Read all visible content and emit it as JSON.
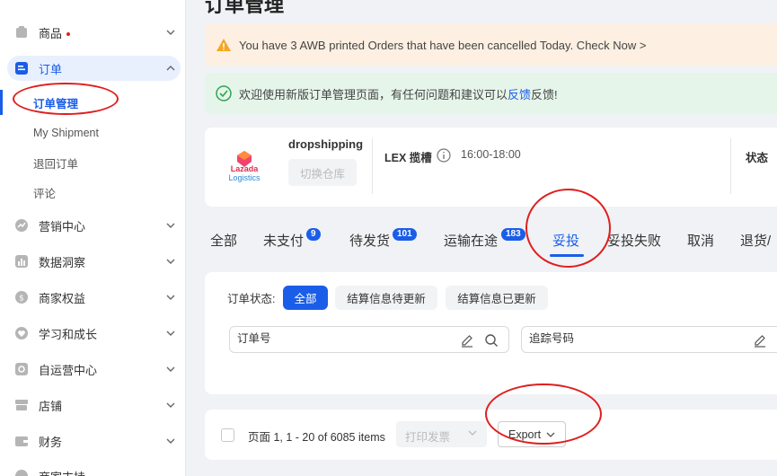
{
  "sidebar": {
    "items": [
      {
        "label": "商品",
        "has_dot": true
      },
      {
        "label": "订单"
      },
      {
        "label": "营销中心"
      },
      {
        "label": "数据洞察"
      },
      {
        "label": "商家权益"
      },
      {
        "label": "学习和成长"
      },
      {
        "label": "自运营中心"
      },
      {
        "label": "店铺"
      },
      {
        "label": "财务"
      },
      {
        "label": "商家支持"
      }
    ],
    "sub_items": [
      {
        "label": "订单管理"
      },
      {
        "label": "My Shipment"
      },
      {
        "label": "退回订单"
      },
      {
        "label": "评论"
      }
    ]
  },
  "page": {
    "title": "订单管理"
  },
  "notices": {
    "warning_text": "You have 3 AWB printed Orders that have been cancelled Today. Check Now >",
    "success_text": "欢迎使用新版订单管理页面，有任何问题和建议可以",
    "success_link": "反馈",
    "success_tail": " 反馈!"
  },
  "info_card": {
    "logo_text_1": "Lazada",
    "logo_text_2": "Logistics",
    "dropshipping_label": "dropshipping",
    "switch_warehouse_label": "切换仓库",
    "lex_label": "LEX 揽槽",
    "lex_time": "16:00-18:00",
    "status_label": "状态"
  },
  "tabs": [
    {
      "label": "全部"
    },
    {
      "label": "未支付",
      "badge": "9"
    },
    {
      "label": "待发货",
      "badge": "101"
    },
    {
      "label": "运输在途",
      "badge": "183"
    },
    {
      "label": "妥投",
      "active": true
    },
    {
      "label": "妥投失败"
    },
    {
      "label": "取消"
    },
    {
      "label": "退货/"
    }
  ],
  "filter": {
    "status_label": "订单状态:",
    "chips": [
      {
        "label": "全部",
        "selected": true
      },
      {
        "label": "结算信息待更新"
      },
      {
        "label": "结算信息已更新"
      }
    ],
    "order_no_placeholder": "订单号",
    "tracking_no_placeholder": "追踪号码"
  },
  "bottom_bar": {
    "pagination_text": "页面 1, 1 - 20 of 6085 items",
    "print_invoice_label": "打印发票",
    "export_label": "Export"
  },
  "colors": {
    "accent": "#1a5de8",
    "annotation": "#e01e1e",
    "warning_bg": "#fdf0e2",
    "success_bg": "#e6f5ea"
  }
}
